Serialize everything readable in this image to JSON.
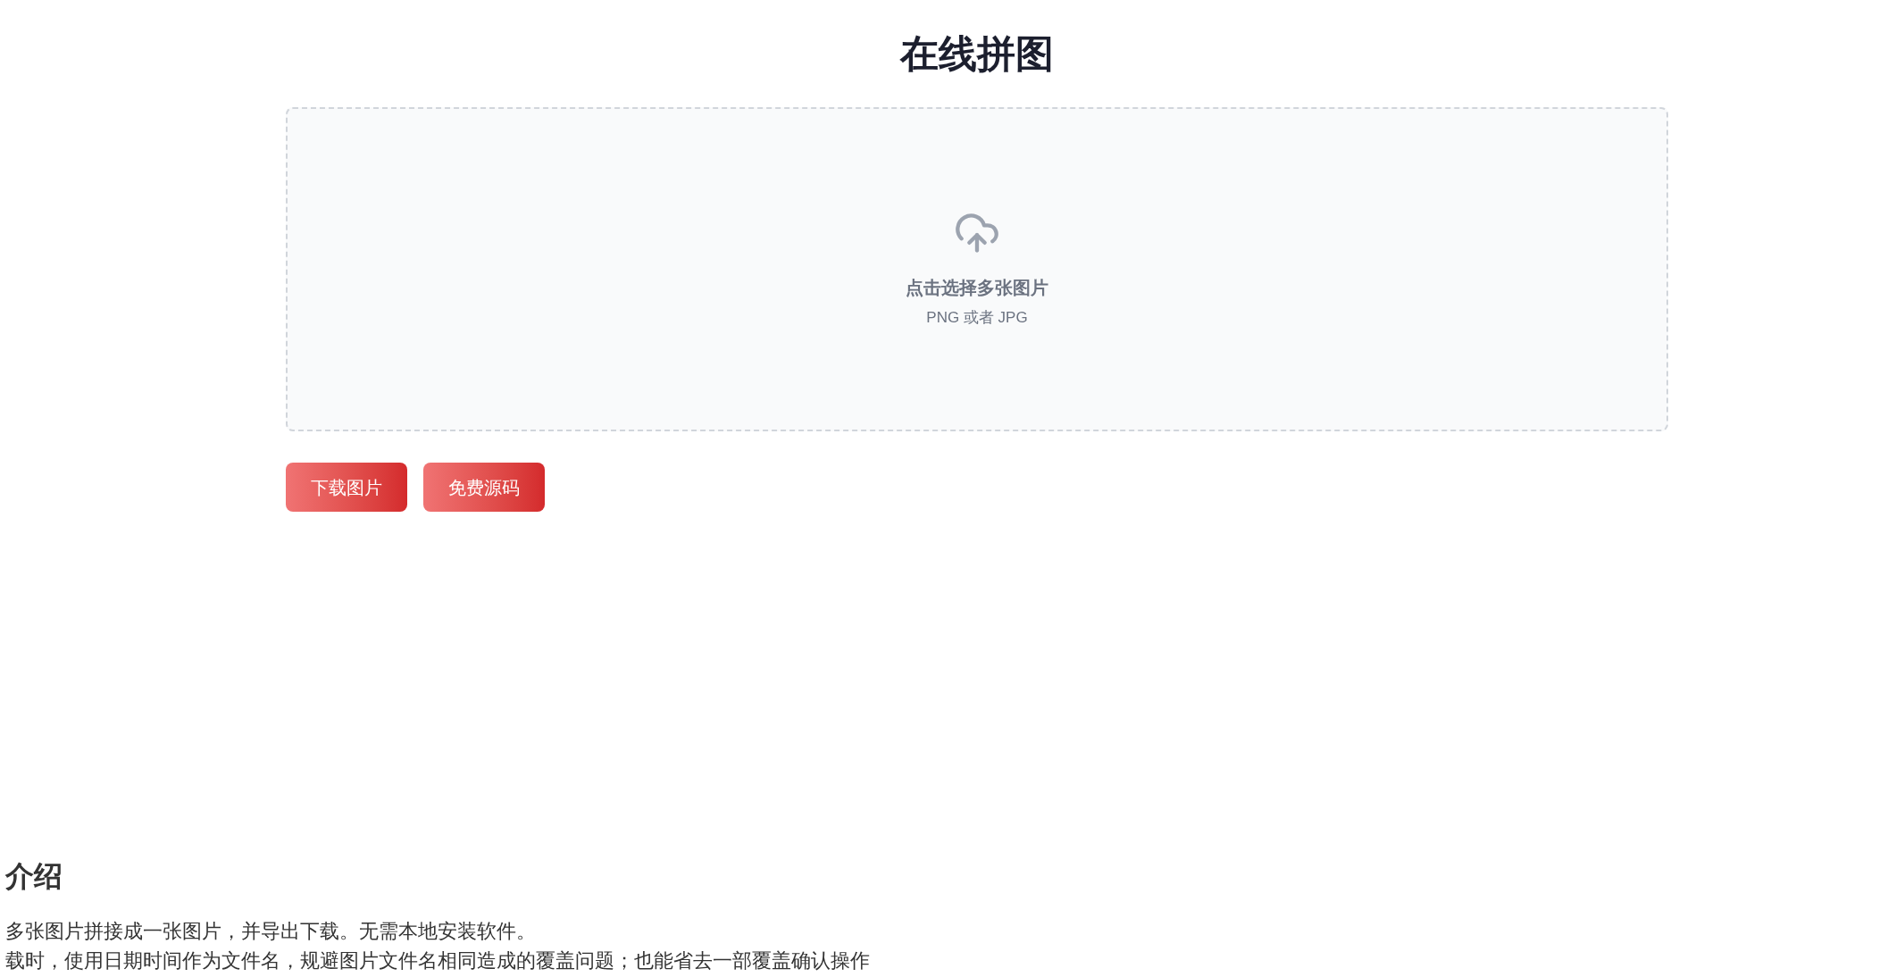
{
  "title": "在线拼图",
  "upload": {
    "prompt": "点击选择多张图片",
    "formats": "PNG 或者 JPG"
  },
  "buttons": [
    {
      "label": "下载图片"
    },
    {
      "label": "免费源码"
    }
  ],
  "intro": {
    "heading": "介绍",
    "lines": [
      "多张图片拼接成一张图片，并导出下载。无需本地安装软件。",
      "载时，使用日期时间作为文件名，规避图片文件名相同造成的覆盖问题；也能省去一部覆盖确认操作"
    ]
  }
}
